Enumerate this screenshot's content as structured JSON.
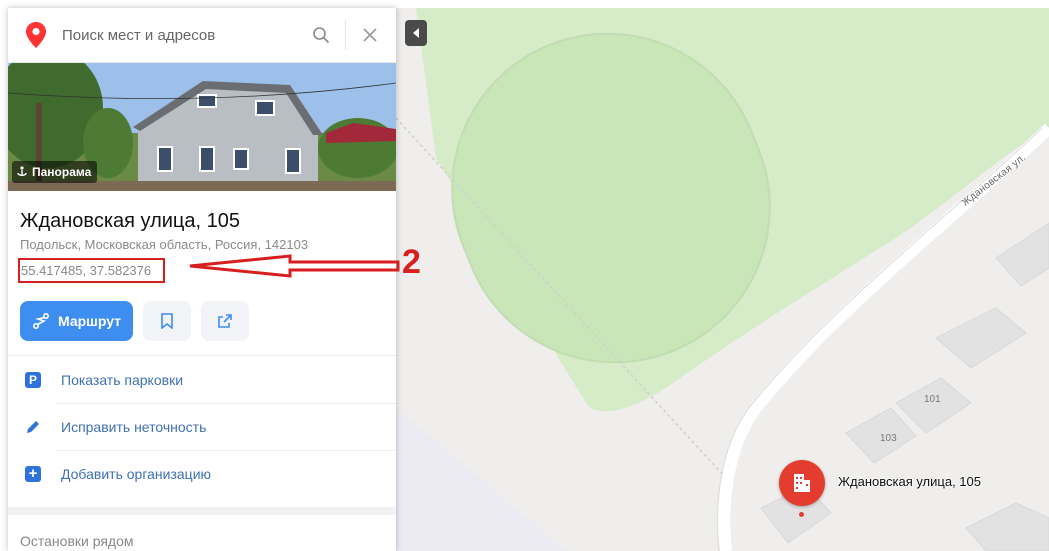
{
  "search": {
    "placeholder": "Поиск мест и адресов",
    "value": "",
    "search_icon": "search-icon",
    "close_icon": "close-icon"
  },
  "panorama": {
    "label": "Панорама",
    "icon": "panorama-icon"
  },
  "place": {
    "title": "Ждановская улица, 105",
    "address": "Подольск, Московская область, Россия, 142103",
    "coordinates": "55.417485, 37.582376"
  },
  "annotation": {
    "number": "2",
    "color": "#d81e1e"
  },
  "actions": {
    "route_label": "Маршрут",
    "bookmark_icon": "bookmark-icon",
    "share_icon": "share-icon",
    "accent": "#3e8df0"
  },
  "menu": [
    {
      "label": "Показать парковки",
      "icon": "parking-icon",
      "glyph": "P"
    },
    {
      "label": "Исправить неточность",
      "icon": "pencil-icon"
    },
    {
      "label": "Добавить организацию",
      "icon": "plus-icon",
      "glyph": "+"
    }
  ],
  "stops": {
    "heading": "Остановки рядом"
  },
  "map": {
    "street_label": "Ждановская ул.",
    "house_numbers": [
      "101",
      "103"
    ],
    "poi_label": "Ждановская улица, 105",
    "poi_color": "#e43d30"
  }
}
